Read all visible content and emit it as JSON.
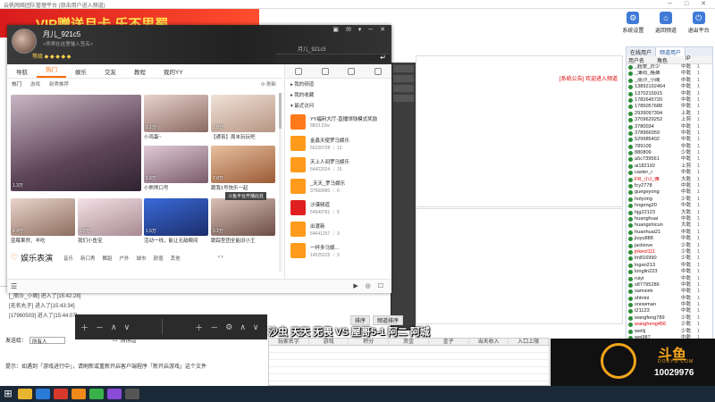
{
  "bg": {
    "title": "云帆网络团队管理平台 (双击用户进入频道)",
    "banner": "VIP赠送月卡 乐不思蜀",
    "toolbar": [
      {
        "label": "系统设置",
        "icon": "gear-icon"
      },
      {
        "label": "返回频道",
        "icon": "home-icon"
      },
      {
        "label": "退出平台",
        "icon": "exit-icon"
      }
    ],
    "system_notice": "[系统公告] 欢迎进入频道",
    "user_tabs": [
      "在线用户",
      "频道用户"
    ],
    "user_cols": [
      "用户名",
      "角色",
      "IP"
    ],
    "users": [
      {
        "name": "_超爱_厉少",
        "role": "中乾",
        "count": "1",
        "red": false
      },
      {
        "name": "_薄荷_格桑",
        "role": "中乾",
        "count": "1",
        "red": false
      },
      {
        "name": "_丽沙_小阁",
        "role": "中乾",
        "count": "1",
        "red": false
      },
      {
        "name": "13892192464",
        "role": "中乾",
        "count": "1",
        "red": false
      },
      {
        "name": "1370215915",
        "role": "中乾",
        "count": "1",
        "red": false
      },
      {
        "name": "1782645720",
        "role": "中乾",
        "count": "1",
        "red": false
      },
      {
        "name": "1785057688",
        "role": "中乾",
        "count": "1",
        "red": false
      },
      {
        "name": "2939097394",
        "role": "上乾",
        "count": "1",
        "red": false
      },
      {
        "name": "3709629252",
        "role": "上剪",
        "count": "1",
        "red": false
      },
      {
        "name": "3780034",
        "role": "中乾",
        "count": "1",
        "red": false
      },
      {
        "name": "378966959",
        "role": "中乾",
        "count": "1",
        "red": false
      },
      {
        "name": "529985402",
        "role": "中乾",
        "count": "1",
        "red": false
      },
      {
        "name": "789109",
        "role": "中乾",
        "count": "1",
        "red": false
      },
      {
        "name": "880809",
        "role": "少乾",
        "count": "1",
        "red": false
      },
      {
        "name": "a5c739561",
        "role": "中乾",
        "count": "1",
        "red": false
      },
      {
        "name": "ai182192",
        "role": "上剪",
        "count": "1",
        "red": false
      },
      {
        "name": "caster_r",
        "role": "中乾",
        "count": "1",
        "red": false
      },
      {
        "name": "FR_小J_雅",
        "role": "大乾",
        "count": "1",
        "red": true
      },
      {
        "name": "fcy2778",
        "role": "中乾",
        "count": "1",
        "red": false
      },
      {
        "name": "guegeyong",
        "role": "中乾",
        "count": "1",
        "red": false
      },
      {
        "name": "hotyong",
        "role": "少乾",
        "count": "1",
        "red": false
      },
      {
        "name": "hogeng20",
        "role": "中乾",
        "count": "1",
        "red": false
      },
      {
        "name": "hjg22123",
        "role": "大乾",
        "count": "1",
        "red": false
      },
      {
        "name": "huanghuai",
        "role": "中乾",
        "count": "1",
        "red": false
      },
      {
        "name": "huangshicun",
        "role": "大乾",
        "count": "1",
        "red": false
      },
      {
        "name": "huanhuai21",
        "role": "中乾",
        "count": "1",
        "red": false
      },
      {
        "name": "jiuyu888",
        "role": "中乾",
        "count": "1",
        "red": false
      },
      {
        "name": "jackiove",
        "role": "少乾",
        "count": "1",
        "red": false
      },
      {
        "name": "jnkeol111",
        "role": "少乾",
        "count": "1",
        "red": true
      },
      {
        "name": "lm816990",
        "role": "少乾",
        "count": "1",
        "red": false
      },
      {
        "name": "logan213",
        "role": "中乾",
        "count": "1",
        "red": false
      },
      {
        "name": "longlin223",
        "role": "中乾",
        "count": "1",
        "red": false
      },
      {
        "name": "ruiyi",
        "role": "中乾",
        "count": "1",
        "red": false
      },
      {
        "name": "s87795286",
        "role": "中乾",
        "count": "1",
        "red": false
      },
      {
        "name": "samsimi",
        "role": "中乾",
        "count": "1",
        "red": false
      },
      {
        "name": "shtnini",
        "role": "中乾",
        "count": "1",
        "red": false
      },
      {
        "name": "snowman",
        "role": "中乾",
        "count": "1",
        "red": false
      },
      {
        "name": "t21123",
        "role": "中乾",
        "count": "1",
        "red": false
      },
      {
        "name": "wangfeng789",
        "role": "少乾",
        "count": "1",
        "red": false
      },
      {
        "name": "wangheng456",
        "role": "少乾",
        "count": "1",
        "red": true
      },
      {
        "name": "weilij",
        "role": "少乾",
        "count": "1",
        "red": false
      },
      {
        "name": "wei987",
        "role": "中乾",
        "count": "1",
        "red": false
      },
      {
        "name": "xiyou8888",
        "role": "中乾",
        "count": "1",
        "red": false
      }
    ],
    "log_lines": [
      "[_丽沙_小阁] 进入了[15:42:28]",
      "[无名丸子] 进入了[15:43:34]",
      "[17960503] 进入了[15:44:07]"
    ],
    "send_label": "发送给：",
    "send_target": "所有人",
    "send_checkbox": "悄悄话",
    "tip": "提示：如遇到「游戏进行中」，请刷新或重新开启客户端程序「新开启游戏」这个文件",
    "mid_tabs": [
      "排序",
      "频道排序"
    ],
    "subtitle": "沙虫 天天 无畏 VS 屋哥5-1 阿二 阿城",
    "table_cols": [
      "玩家名字",
      "游戏",
      "积分",
      "资金",
      "金子",
      "当天收入",
      "入口上限"
    ],
    "obs_controls": [
      "＋",
      "－",
      "∧",
      "∨"
    ],
    "obs_controls2": [
      "＋",
      "－",
      "⚙",
      "∧",
      "∨"
    ],
    "douyu": {
      "name": "斗鱼",
      "sub": "DOUYU.COM",
      "room": "10029976"
    }
  },
  "yy": {
    "user": "月儿_921c5",
    "signature": "<乖乖在这里输入签名>",
    "yyid": "月儿_921c5",
    "badges": "等级 ◆ ◆ ◆ ◆ ◆",
    "nav": [
      "导航",
      "热门",
      "娱乐",
      "交友",
      "教程",
      "我的YY"
    ],
    "nav_active": 1,
    "sub": [
      "热门",
      "游戏",
      "新秀推荐"
    ],
    "refresh": "刷新",
    "cards": [
      {
        "title": "",
        "count": "1.3万"
      },
      {
        "title": "小鸡蛋~",
        "count": "2.1万"
      },
      {
        "title": "【通宵】周末玩玩吧",
        "count": "2.8万"
      },
      {
        "title": "小熊熊口号",
        "count": "1.6万"
      },
      {
        "title": "跟我1号快乐一起",
        "count": "7.8万"
      },
      {
        "title": "蓝莓果然、羊吃",
        "count": "4.4万"
      },
      {
        "title": "我们小鱼宝",
        "count": "9.5万"
      },
      {
        "title": "活动一线，能让无敌瞬间",
        "count": "1.5万"
      },
      {
        "title": "跟踪型团全能旧小王",
        "count": "3.2万"
      }
    ],
    "hover_tip": "斗鱼平台开播此处",
    "ent_title": "娱乐表演",
    "ent_tags": [
      "音乐",
      "新口秀",
      "舞蹈",
      "户外",
      "城市",
      "颜值",
      "其他"
    ],
    "right_sections": [
      "我的频道",
      "我的收藏",
      "最近访问"
    ],
    "channels": [
      {
        "title": "YY福利大厅-直播领钱模式奖励",
        "meta": "8833.23w",
        "color": "#ff7a1a"
      },
      {
        "title": "金鑫天使罗马娱乐",
        "meta": "56150728 ｜ 12",
        "color": "#ff9a1a"
      },
      {
        "title": "天上人间罗马娱乐",
        "meta": "54422024 ｜ 15",
        "color": "#ff9a1a"
      },
      {
        "title": "_天天_罗马娱乐",
        "meta": "37560980 ｜ 6",
        "color": "#ff9a1a"
      },
      {
        "title": "沙漠频道",
        "meta": "54949791 ｜ 6",
        "color": "#e02020"
      },
      {
        "title": "出渡新",
        "meta": "54641257 ｜ 3",
        "color": "#ff9a1a"
      },
      {
        "title": "一杯多马娱...",
        "meta": "14525225 ｜ 3",
        "color": "#ff9a1a"
      }
    ]
  }
}
